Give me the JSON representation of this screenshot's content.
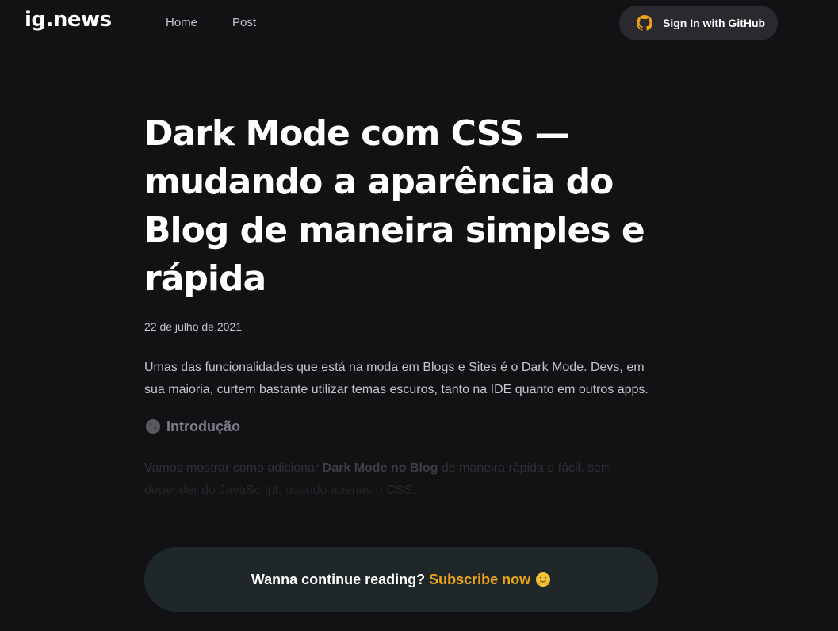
{
  "header": {
    "logo": "ig.news",
    "nav": [
      "Home",
      "Post"
    ],
    "signin_label": "Sign In with GitHub",
    "signin_icon": "github-icon"
  },
  "post": {
    "title": "Dark Mode com CSS — mudando a aparência do Blog de maneira simples e rápida",
    "date": "22 de julho de 2021",
    "lead": "Umas das funcionalidades que está na moda em Blogs e Sites é o Dark Mode. Devs, em sua maioria, curtem bastante utilizar temas escuros, tanto na IDE quanto em outros apps.",
    "intro_icon": "moon-emoji-icon",
    "intro_heading": "Introdução",
    "preview_before": "Vamos mostrar como adicionar ",
    "preview_bold": "Dark Mode no Blog",
    "preview_after": " de maneira rápida e fácil, sem depender do JavaScript, usando apenas o CSS."
  },
  "cta": {
    "prompt": "Wanna continue reading?",
    "link": "Subscribe now",
    "emoji": "hugging-face-emoji-icon"
  },
  "colors": {
    "background": "#121214",
    "accent": "#eba417",
    "button_bg": "#29292e",
    "cta_bg": "#1f2729"
  }
}
